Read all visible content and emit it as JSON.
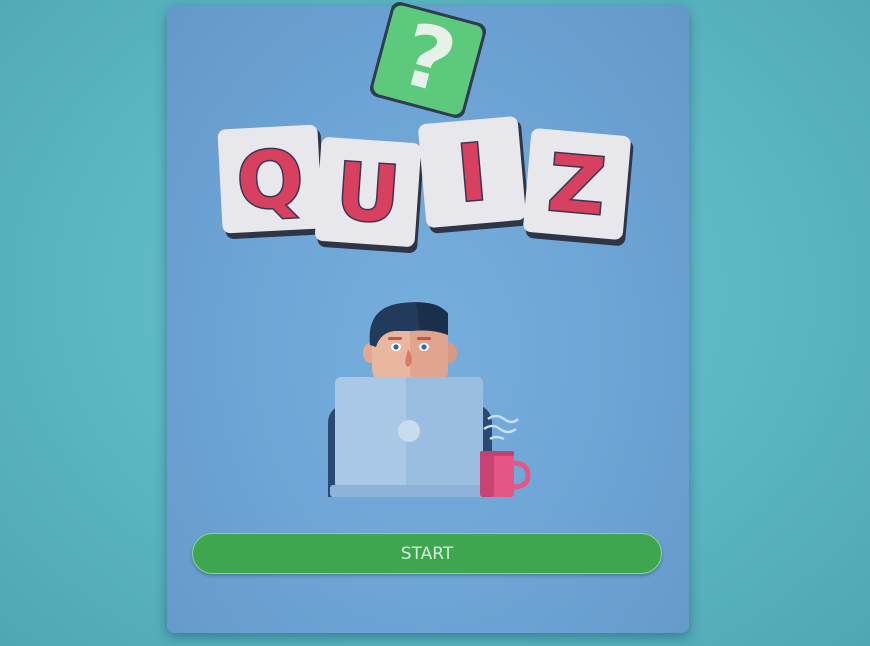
{
  "logo": {
    "title_letters": [
      "Q",
      "U",
      "I",
      "Z"
    ],
    "badge_symbol": "?"
  },
  "illustration": {
    "subject": "person-with-laptop-and-coffee-mug"
  },
  "start_button": {
    "label": "START"
  },
  "colors": {
    "background": "#5bb7c2",
    "card": "#6ea5d6",
    "tile": "#e7e7ec",
    "letter": "#d7415f",
    "badge": "#5cc97d",
    "button": "#3ea64e",
    "mug": "#e35686"
  }
}
